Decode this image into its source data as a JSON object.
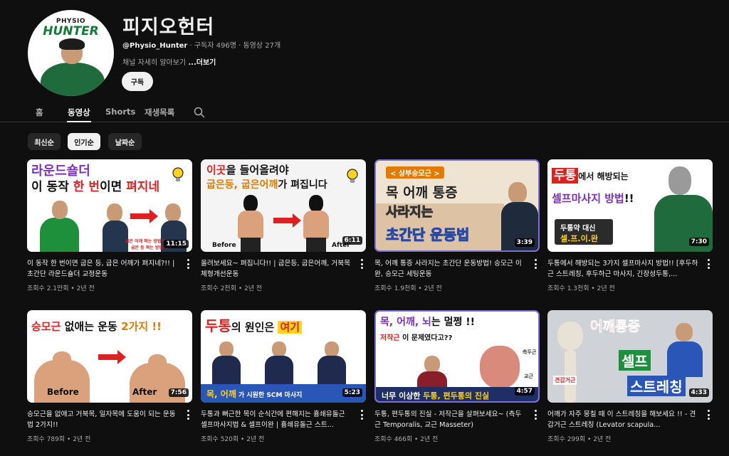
{
  "channel": {
    "logo_small": "PHYSIO",
    "logo_main": "HUNTER",
    "name": "피지오헌터",
    "handle": "@Physio_Hunter",
    "meta": "· 구독자 496명 · 동영상 27개",
    "desc": "채널 자세히 알아보기",
    "more": "...더보기",
    "subscribe_label": "구독"
  },
  "tabs": [
    "홈",
    "동영상",
    "Shorts",
    "재생목록"
  ],
  "active_tab": "동영상",
  "chips": [
    "최신순",
    "인기순",
    "날짜순"
  ],
  "active_chip": "인기순",
  "colors": {
    "background": "#0f0f0f",
    "text": "#f1f1f1",
    "secondary": "#aaaaaa",
    "chip": "#272727"
  },
  "videos": [
    {
      "title": "이 동작 한 번이면 굽은 등, 굽은 어깨가 펴지네?!! | 초간단 라운드숄더 교정운동",
      "stats": "조회수 2.1만회 • 2년 전",
      "duration": "11:15",
      "thumb": {
        "line1": "라운드숄더",
        "line2a": "이 동작 ",
        "line2b": "한 번",
        "line2c": "이면 ",
        "line2d": "펴지네",
        "note1": "굽은 어깨 펴는 방법??",
        "note2": "굽은 등 펴는 방법??"
      }
    },
    {
      "title": "올려보세요~ 펴집니다!! | 굽은등, 굽은어깨, 거북목 체형개선운동",
      "stats": "조회수 2천회 • 2년 전",
      "duration": "6:11",
      "thumb": {
        "line1a": "이곳",
        "line1b": "을 들어올려야",
        "line2a": "굽은등, 굽은어깨",
        "line2b": "가 펴집니다",
        "before": "Before",
        "after": "After"
      }
    },
    {
      "title": "목, 어깨 통증 사라지는 초간단 운동방법! 승모근 이완, 승모근 세팅운동",
      "stats": "조회수 1.9천회 • 2년 전",
      "duration": "3:39",
      "thumb": {
        "tag": "< 상부승모근 >",
        "line1": "목 어깨 통증",
        "line2": "사라지는",
        "line3": "초간단 운동법"
      }
    },
    {
      "title": "두통에서 해방되는 3가지 셀프마사지 방법!! [후두하근 스트레칭, 후두하근 마사지, 긴장성두통,...",
      "stats": "조회수 1.3천회 • 2년 전",
      "duration": "7:30",
      "thumb": {
        "line1a": "두통",
        "line1b": "에서 해방되는",
        "line2": "셀프마사지 방법",
        "box1": "두통약 대신",
        "box2": "셀.프.이.완"
      }
    },
    {
      "title": "승모근을 없애고 거북목, 일자목에 도움이 되는 운동법 2가지!!",
      "stats": "조회수 789회 • 2년 전",
      "duration": "7:56",
      "thumb": {
        "line1a": "승모근",
        "line1b": " 없애는 운동 ",
        "line1c": "2가지 !!",
        "before": "Before",
        "after": "After"
      }
    },
    {
      "title": "두통과 뻐근한 목이 순식간에 편해지는 흉쇄유돌근 셀프마사지법 & 셀프이완 | 흉쇄유돌근 스트...",
      "stats": "조회수 520회 • 2년 전",
      "duration": "5:23",
      "thumb": {
        "line1a": "두통",
        "line1b": "의 원인은 ",
        "line1c": "여기",
        "bar_a": "목, 어깨",
        "bar_b": " 가 시원한 SCM 마사지"
      }
    },
    {
      "title": "두통, 편두통의 진실 - 저작근을 살펴보세요~ (측두근 Temporalis, 교근 Masseter)",
      "stats": "조회수 466회 • 2년 전",
      "duration": "4:57",
      "thumb": {
        "line1a": "목, 어깨, 뇌",
        "line1b": "는 멀쩡 !!",
        "line2a": "저작근",
        "line2b": " 이 문제였다고??",
        "label1": "측두근",
        "label2": "교근",
        "bar_a": "너무 이상한 ",
        "bar_b": "두통, 편두통의 진실"
      }
    },
    {
      "title": "어깨가 자주 뭉칠 때 이 스트레칭을 해보세요 !! - 견갑거근 스트레칭 (Levator scapula...",
      "stats": "조회수 299회 • 2년 전",
      "duration": "4:33",
      "thumb": {
        "line1": "어깨통증",
        "line2": "셀프",
        "line3": "스트레칭",
        "label": "견갑거근"
      }
    }
  ]
}
